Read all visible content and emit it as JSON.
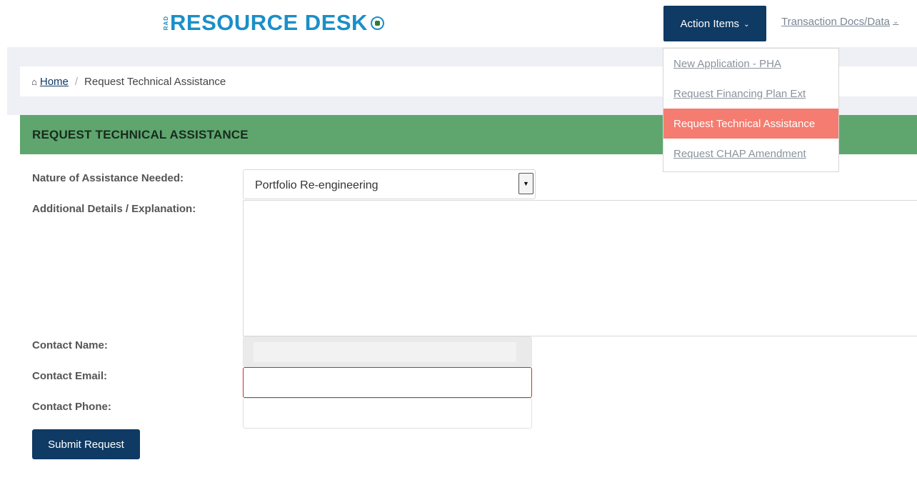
{
  "header": {
    "logo_prefix": "RAD",
    "logo_text": "RESOURCE DESK",
    "logo_seal_icon": "hud-seal-icon",
    "action_items_label": "Action Items",
    "transaction_label": "Transaction Docs/Data"
  },
  "dropdown": {
    "items": [
      {
        "label": "New Application - PHA",
        "active": false
      },
      {
        "label": "Request Financing Plan Ext",
        "active": false
      },
      {
        "label": "Request Technical Assistance",
        "active": true
      },
      {
        "label": "Request CHAP Amendment",
        "active": false
      }
    ],
    "active_color": "#f47c70"
  },
  "breadcrumb": {
    "home_icon": "home-icon",
    "home_label": "Home",
    "separator": "/",
    "current": "Request Technical Assistance"
  },
  "panel": {
    "title": "REQUEST TECHNICAL ASSISTANCE",
    "header_color": "#5fa66e"
  },
  "form": {
    "nature_label": "Nature of Assistance Needed:",
    "nature_value": "Portfolio Re-engineering",
    "details_label": "Additional Details / Explanation:",
    "details_value": "",
    "contact_name_label": "Contact Name:",
    "contact_name_value": "",
    "contact_email_label": "Contact Email:",
    "contact_email_value": "",
    "contact_phone_label": "Contact Phone:",
    "contact_phone_value": "",
    "submit_label": "Submit Request"
  },
  "colors": {
    "brand_blue": "#1a8fc8",
    "navy": "#0e3a64",
    "invalid_border": "#c9302c"
  }
}
